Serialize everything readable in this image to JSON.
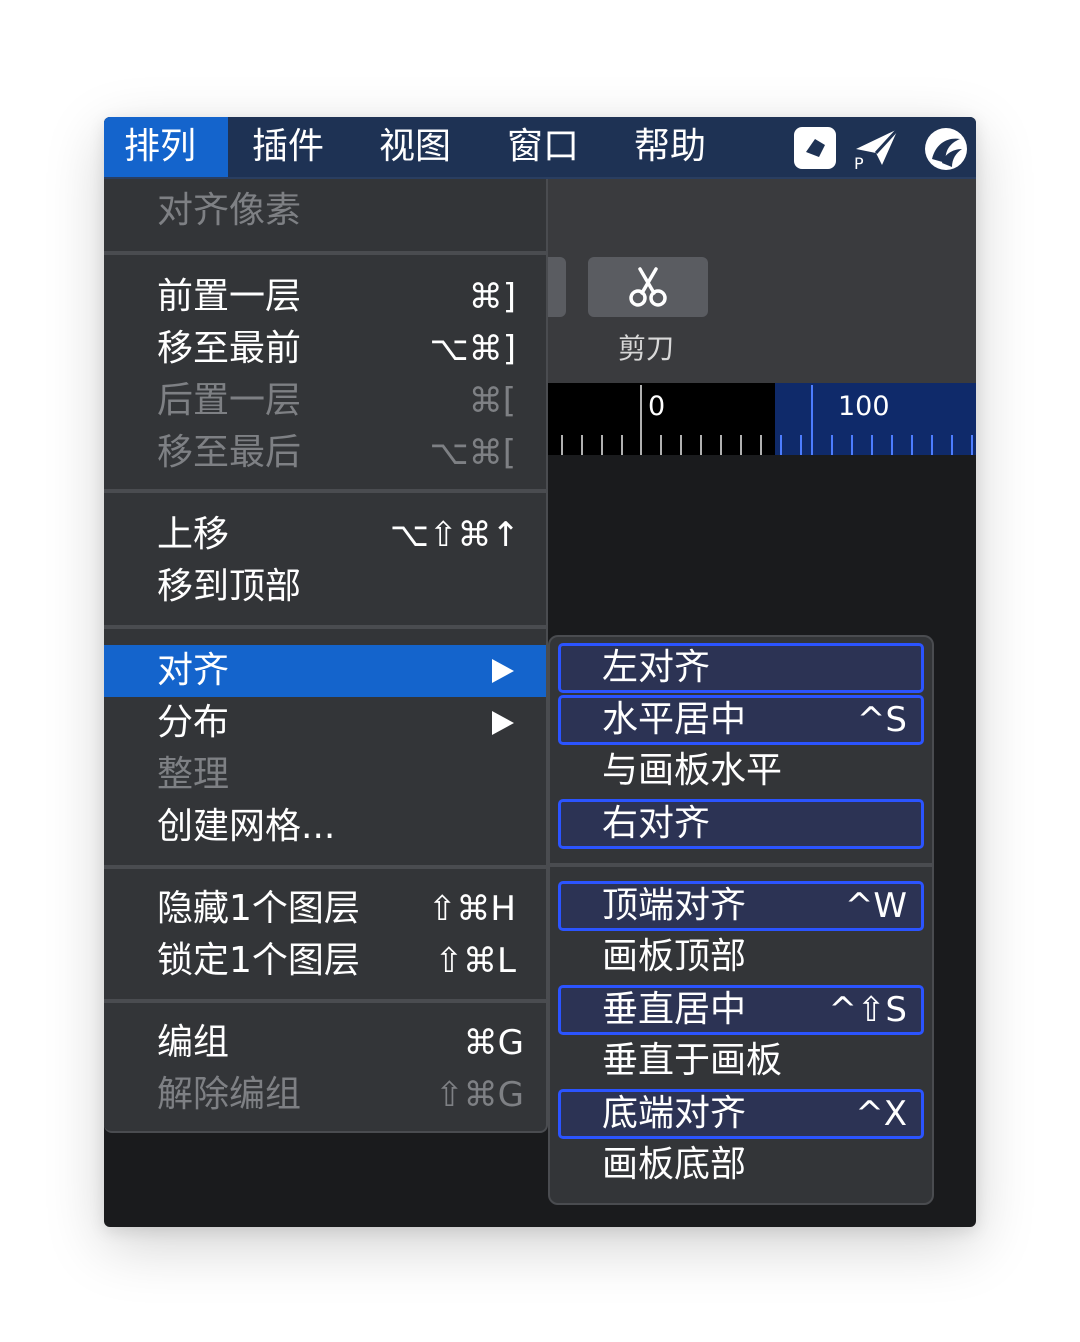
{
  "menubar": {
    "items": [
      "排列",
      "插件",
      "视图",
      "窗口",
      "帮助"
    ]
  },
  "icons": {
    "tool_icon": "scissors-icon",
    "status_icons": [
      "sketch-diamond-icon",
      "paper-plane-pr-icon",
      "swirl-logo-icon"
    ]
  },
  "toolbar": {
    "scissors_label": "剪刀"
  },
  "ruler": {
    "mark_0": "0",
    "mark_100": "100"
  },
  "menu": {
    "items": [
      {
        "label": "对齐像素",
        "shortcut": "",
        "disabled": true
      },
      {
        "label": "前置一层",
        "shortcut": "⌘]"
      },
      {
        "label": "移至最前",
        "shortcut": "⌥⌘]"
      },
      {
        "label": "后置一层",
        "shortcut": "⌘[",
        "disabled": true
      },
      {
        "label": "移至最后",
        "shortcut": "⌥⌘[",
        "disabled": true
      },
      {
        "label": "上移",
        "shortcut": "⌥⇧⌘↑"
      },
      {
        "label": "移到顶部",
        "shortcut": ""
      },
      {
        "label": "对齐",
        "submenu": true,
        "highlighted": true
      },
      {
        "label": "分布",
        "submenu": true
      },
      {
        "label": "整理",
        "disabled": true
      },
      {
        "label": "创建网格..."
      },
      {
        "label": "隐藏1个图层",
        "shortcut": "⇧⌘H"
      },
      {
        "label": "锁定1个图层",
        "shortcut": "⇧⌘L"
      },
      {
        "label": "编组",
        "shortcut": "⌘G"
      },
      {
        "label": "解除编组",
        "shortcut": "⇧⌘G",
        "disabled": true
      }
    ]
  },
  "submenu": {
    "items": [
      {
        "label": "左对齐",
        "shortcut": ""
      },
      {
        "label": "水平居中",
        "shortcut": "^S"
      },
      {
        "label": "与画板水平",
        "shortcut": ""
      },
      {
        "label": "右对齐",
        "shortcut": ""
      },
      {
        "label": "顶端对齐",
        "shortcut": "^W"
      },
      {
        "label": "画板顶部",
        "shortcut": ""
      },
      {
        "label": "垂直居中",
        "shortcut": "^⇧S"
      },
      {
        "label": "垂直于画板",
        "shortcut": ""
      },
      {
        "label": "底端对齐",
        "shortcut": "^X"
      },
      {
        "label": "画板底部",
        "shortcut": ""
      }
    ]
  },
  "colors": {
    "menubar_bg": "#1e3254",
    "highlight": "#1464cc",
    "menu_bg": "#333538",
    "box_border": "#2b54ff",
    "disabled_text": "#7e8084"
  }
}
